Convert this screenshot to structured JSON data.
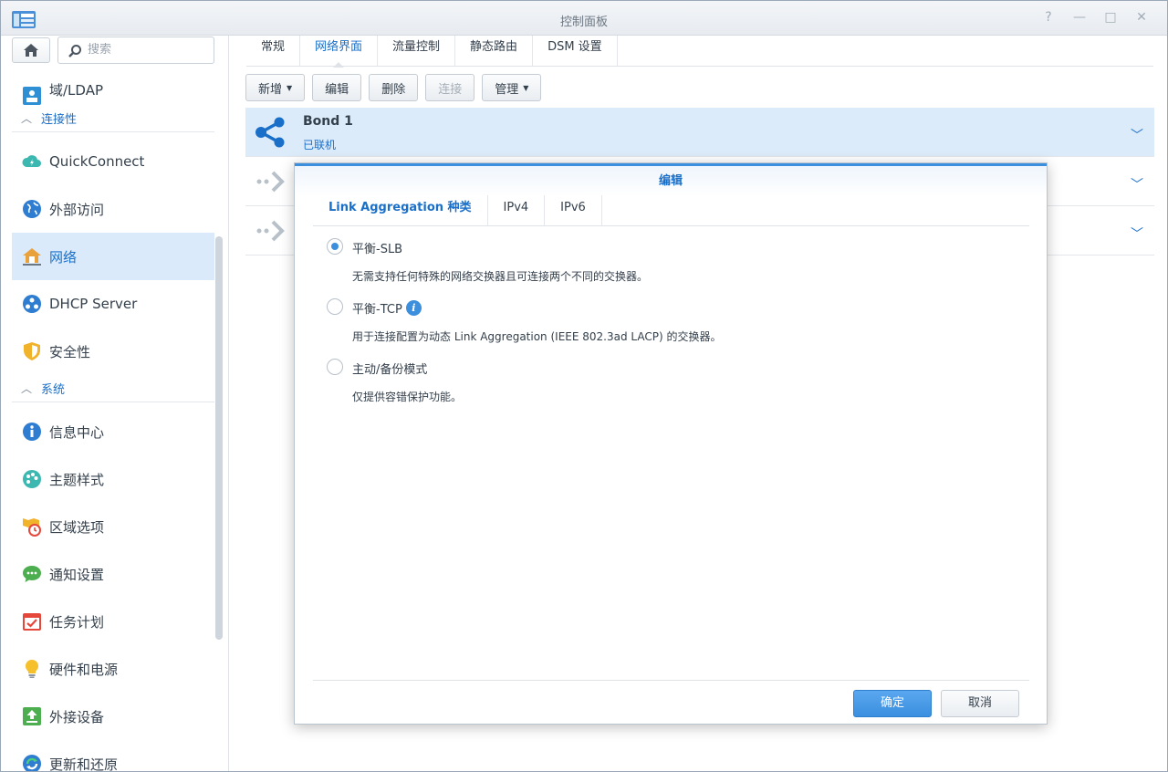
{
  "window": {
    "title": "控制面板"
  },
  "window_controls": {
    "help": "?",
    "minimize": "—",
    "maximize": "□",
    "close": "✕"
  },
  "sidebar": {
    "search_placeholder": "搜索",
    "cut_item": "域/LDAP",
    "sections": [
      {
        "label": "连接性",
        "items": [
          "QuickConnect",
          "外部访问",
          "网络",
          "DHCP Server",
          "安全性"
        ]
      },
      {
        "label": "系统",
        "items": [
          "信息中心",
          "主题样式",
          "区域选项",
          "通知设置",
          "任务计划",
          "硬件和电源",
          "外接设备",
          "更新和还原"
        ]
      }
    ],
    "active_item": "网络"
  },
  "main": {
    "tabs": [
      "常规",
      "网络界面",
      "流量控制",
      "静态路由",
      "DSM 设置"
    ],
    "active_tab": "网络界面",
    "toolbar": {
      "add": "新增",
      "edit": "编辑",
      "delete": "删除",
      "connect": "连接",
      "manage": "管理"
    },
    "interfaces": [
      {
        "name": "Bond 1",
        "status": "已联机"
      },
      {
        "name": "",
        "status": ""
      },
      {
        "name": "",
        "status": ""
      }
    ]
  },
  "modal": {
    "title": "编辑",
    "tabs": [
      "Link Aggregation 种类",
      "IPv4",
      "IPv6"
    ],
    "active_tab": "Link Aggregation 种类",
    "options": [
      {
        "label": "平衡-SLB",
        "desc": "无需支持任何特殊的网络交换器且可连接两个不同的交换器。",
        "selected": true
      },
      {
        "label": "平衡-TCP",
        "desc": "用于连接配置为动态 Link Aggregation (IEEE 802.3ad LACP) 的交换器。",
        "selected": false
      },
      {
        "label": "主动/备份模式",
        "desc": "仅提供容错保护功能。",
        "selected": false
      }
    ],
    "ok": "确定",
    "cancel": "取消"
  },
  "colors": {
    "accent": "#3c8fdd",
    "link": "#1a6fc9",
    "selected_row": "#dcebf9"
  }
}
